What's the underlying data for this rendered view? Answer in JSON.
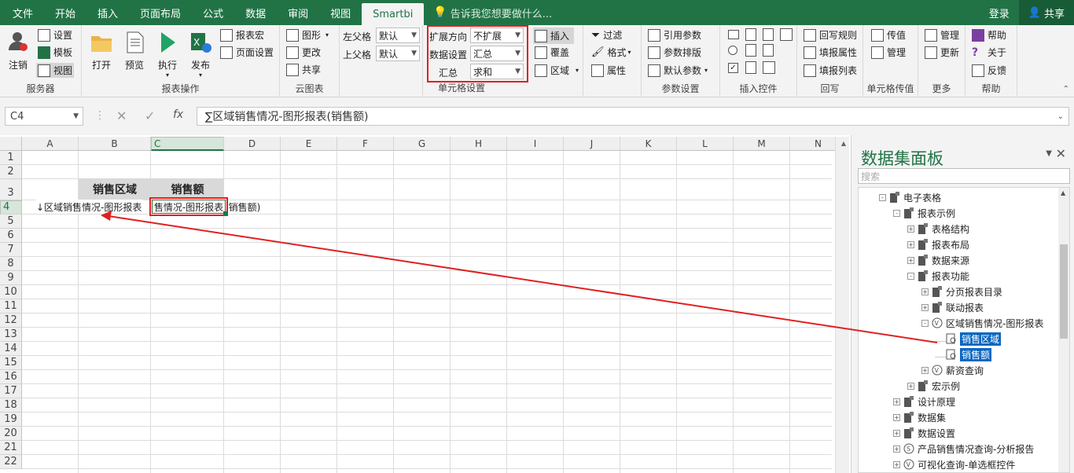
{
  "menu": {
    "tabs": [
      "文件",
      "开始",
      "插入",
      "页面布局",
      "公式",
      "数据",
      "审阅",
      "视图",
      "Smartbi"
    ],
    "active": "Smartbi",
    "tell_me": "告诉我您想要做什么...",
    "login": "登录",
    "share": "共享"
  },
  "ribbon": {
    "server": {
      "logout": "注销",
      "settings": "设置",
      "template": "模板",
      "view": "视图",
      "label": "服务器"
    },
    "report_ops": {
      "open": "打开",
      "preview": "预览",
      "execute": "执行",
      "publish": "发布",
      "report_macro": "报表宏",
      "page_setup": "页面设置",
      "label": "报表操作"
    },
    "cloud_chart": {
      "chart": "图形",
      "change": "更改",
      "share": "共享",
      "label": "云图表"
    },
    "parent": {
      "left_label": "左父格",
      "left_value": "默认",
      "top_label": "上父格",
      "top_value": "默认"
    },
    "cell_settings": {
      "expand_label": "扩展方向",
      "expand_value": "不扩展",
      "data_label": "数据设置",
      "data_value": "汇总",
      "agg_label": "汇总",
      "agg_value": "求和",
      "label": "单元格设置"
    },
    "insert_grp": {
      "insert": "插入",
      "cover": "覆盖",
      "area": "区域"
    },
    "filter_grp": {
      "filter": "过滤",
      "format": "格式",
      "attribute": "属性"
    },
    "params": {
      "ref": "引用参数",
      "layout": "参数排版",
      "default": "默认参数",
      "label": "参数设置"
    },
    "controls": {
      "label": "插入控件"
    },
    "writeback": {
      "rule": "回写规则",
      "fill_attr": "填报属性",
      "fill_list": "填报列表",
      "label": "回写"
    },
    "cell_value": {
      "pass": "传值",
      "manage": "管理",
      "label": "单元格传值"
    },
    "more": {
      "manage": "管理",
      "update": "更新",
      "label": "更多"
    },
    "help": {
      "help": "帮助",
      "about": "关于",
      "feedback": "反馈",
      "label": "帮助"
    }
  },
  "formula_bar": {
    "cell_ref": "C4",
    "cancel": "✕",
    "confirm": "✓",
    "fx": "fx",
    "formula": "∑区域销售情况-图形报表(销售额)"
  },
  "sheet": {
    "columns": [
      "A",
      "B",
      "C",
      "D",
      "E",
      "F",
      "G",
      "H",
      "I",
      "J",
      "K",
      "L",
      "M",
      "N"
    ],
    "rows": [
      "1",
      "2",
      "3",
      "4",
      "5",
      "6",
      "7",
      "8",
      "9",
      "10",
      "11",
      "12",
      "13",
      "14",
      "15",
      "16",
      "17",
      "18",
      "19",
      "20",
      "21",
      "22"
    ],
    "selected_col": "C",
    "selected_row": "4",
    "b3": "销售区域",
    "c3": "销售额",
    "b4": "↓区域销售情况-图形报表",
    "c4": "售情况-图形报表",
    "c4_overflow": "(销售额)"
  },
  "panel": {
    "title": "数据集面板",
    "search": "搜索",
    "tree": [
      {
        "label": "电子表格",
        "level": 0,
        "exp": "-",
        "icon": "folder"
      },
      {
        "label": "报表示例",
        "level": 1,
        "exp": "-",
        "icon": "folder"
      },
      {
        "label": "表格结构",
        "level": 2,
        "exp": "+",
        "icon": "folder"
      },
      {
        "label": "报表布局",
        "level": 2,
        "exp": "+",
        "icon": "folder"
      },
      {
        "label": "数据来源",
        "level": 2,
        "exp": "+",
        "icon": "folder"
      },
      {
        "label": "报表功能",
        "level": 2,
        "exp": "-",
        "icon": "folder"
      },
      {
        "label": "分页报表目录",
        "level": 3,
        "exp": "+",
        "icon": "folder"
      },
      {
        "label": "联动报表",
        "level": 3,
        "exp": "+",
        "icon": "folder"
      },
      {
        "label": "区域销售情况-图形报表",
        "level": 3,
        "exp": "-",
        "icon": "dataset"
      },
      {
        "label": "销售区域",
        "level": 4,
        "exp": "",
        "icon": "field",
        "hl": true
      },
      {
        "label": "销售额",
        "level": 4,
        "exp": "",
        "icon": "field",
        "hl": true
      },
      {
        "label": "薪资查询",
        "level": 3,
        "exp": "+",
        "icon": "dataset"
      },
      {
        "label": "宏示例",
        "level": 2,
        "exp": "+",
        "icon": "folder"
      },
      {
        "label": "设计原理",
        "level": 1,
        "exp": "+",
        "icon": "folder"
      },
      {
        "label": "数据集",
        "level": 1,
        "exp": "+",
        "icon": "folder"
      },
      {
        "label": "数据设置",
        "level": 1,
        "exp": "+",
        "icon": "folder"
      },
      {
        "label": "产品销售情况查询-分析报告",
        "level": 1,
        "exp": "+",
        "icon": "sdataset"
      },
      {
        "label": "可视化查询-单选框控件",
        "level": 1,
        "exp": "+",
        "icon": "dataset"
      }
    ]
  },
  "colors": {
    "brand": "#217346",
    "highlight": "#0b67c2",
    "annotation": "#e02020"
  }
}
